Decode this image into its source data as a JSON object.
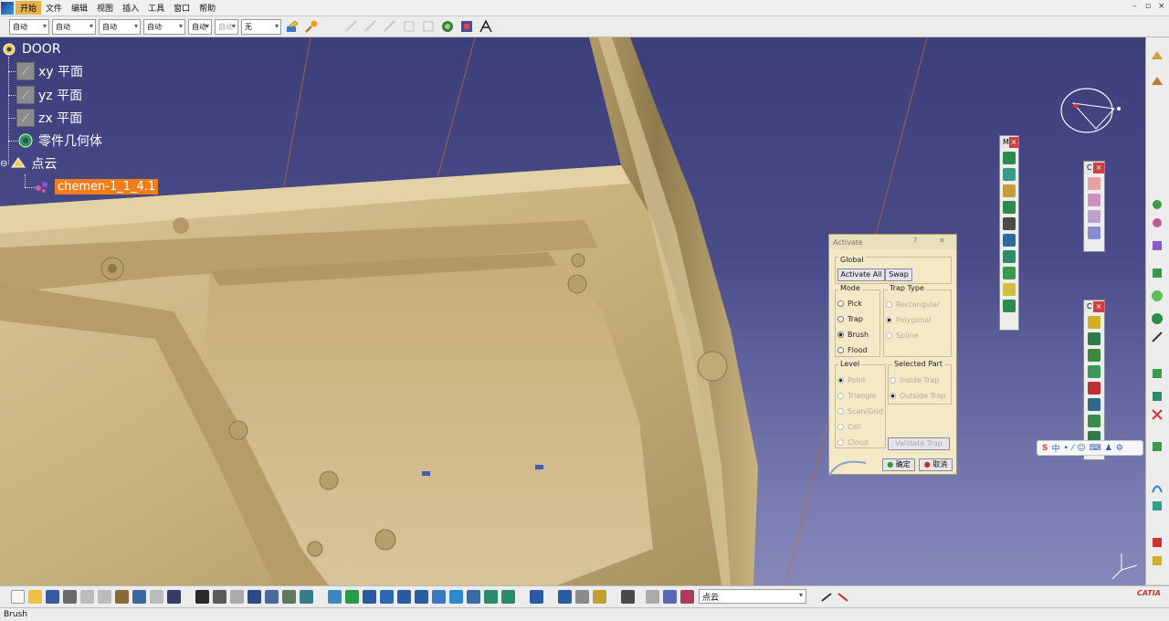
{
  "menu": {
    "items": [
      "开始",
      "文件",
      "编辑",
      "视图",
      "插入",
      "工具",
      "窗口",
      "帮助"
    ],
    "active_index": 0
  },
  "graphic_toolbar": {
    "combos": [
      "自动",
      "自动",
      "自动",
      "自动",
      "自动",
      "自动",
      "无"
    ]
  },
  "tree": {
    "root": "DOOR",
    "nodes": [
      "xy 平面",
      "yz 平面",
      "zx 平面",
      "零件几何体",
      "点云"
    ],
    "selected": "chemen-1_1_4.1"
  },
  "float_bar_labels": [
    "M",
    "C",
    "C"
  ],
  "activate_dialog": {
    "title": "Activate",
    "help": "?",
    "close": "✕",
    "global_label": "Global",
    "activate_all": "Activate All",
    "swap": "Swap",
    "mode_label": "Mode",
    "modes": [
      "Pick",
      "Trap",
      "Brush",
      "Flood"
    ],
    "mode_selected": "Brush",
    "trap_type_label": "Trap Type",
    "trap_types": [
      "Rectangular",
      "Polygonal",
      "Spline"
    ],
    "level_label": "Level",
    "levels": [
      "Point",
      "Triangle",
      "Scan/Grid",
      "Cell",
      "Cloud"
    ],
    "selected_part_label": "Selected Part",
    "selected_parts": [
      "Inside Trap",
      "Outside Trap"
    ],
    "validate_trap": "Validate Trap",
    "ok": "确定",
    "cancel": "取消"
  },
  "ime": {
    "logo": "S",
    "items": [
      "中",
      "•",
      "⁄",
      "☺",
      "⌨",
      "♟",
      "⚙"
    ]
  },
  "selection_combo": "点云",
  "status": {
    "text": "Brush"
  },
  "brand": "CATIA",
  "colors": {
    "viewport_top": "#3c3f7a",
    "viewport_bottom": "#8587ba",
    "part": "#c9b27e",
    "selection": "#f07f1a",
    "dialog_bg": "#f3e9c6"
  }
}
